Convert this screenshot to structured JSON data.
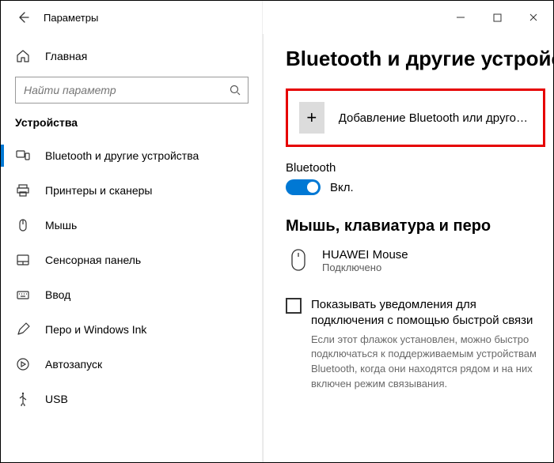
{
  "titlebar": {
    "title": "Параметры"
  },
  "sidebar": {
    "home": "Главная",
    "search_placeholder": "Найти параметр",
    "section": "Устройства",
    "items": [
      {
        "label": "Bluetooth и другие устройства"
      },
      {
        "label": "Принтеры и сканеры"
      },
      {
        "label": "Мышь"
      },
      {
        "label": "Сенсорная панель"
      },
      {
        "label": "Ввод"
      },
      {
        "label": "Перо и Windows Ink"
      },
      {
        "label": "Автозапуск"
      },
      {
        "label": "USB"
      }
    ]
  },
  "main": {
    "title": "Bluetooth и другие устройства",
    "add_device_label": "Добавление Bluetooth или другого устройс...",
    "bluetooth_label": "Bluetooth",
    "bluetooth_state": "Вкл.",
    "group_mouse_kb": "Мышь, клавиатура и перо",
    "device": {
      "name": "HUAWEI  Mouse",
      "status": "Подключено"
    },
    "checkbox_label": "Показывать уведомления для подключения с помощью быстрой связи",
    "checkbox_hint": "Если этот флажок установлен, можно быстро подключаться к поддерживаемым устройствам Bluetooth, когда они находятся рядом и на них включен режим связывания."
  }
}
